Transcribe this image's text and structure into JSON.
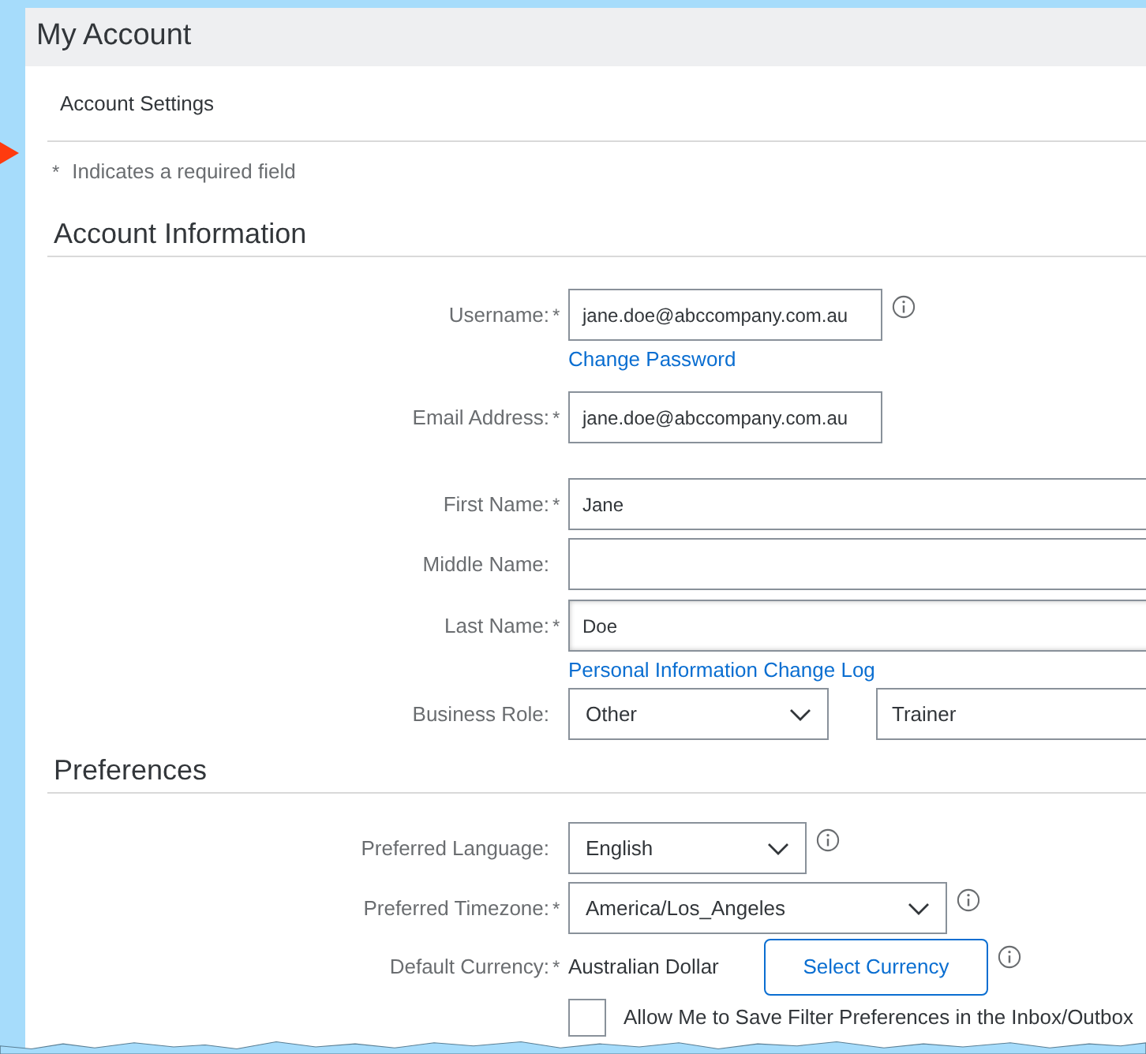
{
  "page": {
    "title": "My Account"
  },
  "tab": {
    "label": "Account Settings"
  },
  "required_note": {
    "mark": "*",
    "text": "Indicates a required field"
  },
  "sections": [
    {
      "title": "Account Information",
      "rows": [
        {
          "kind": "input",
          "label": "Username:",
          "required": true,
          "value": "jane.doe@abccompany.com.au",
          "info": true,
          "link": "Change Password"
        },
        {
          "kind": "input",
          "label": "Email Address:",
          "required": true,
          "value": "jane.doe@abccompany.com.au",
          "info": false
        },
        {
          "kind": "input",
          "label": "First Name:",
          "required": true,
          "value": "Jane",
          "info": false
        },
        {
          "kind": "input",
          "label": "Middle Name:",
          "required": false,
          "value": "",
          "info": false
        },
        {
          "kind": "input",
          "label": "Last Name:",
          "required": true,
          "value": "Doe",
          "info": false,
          "link": "Personal Information Change Log"
        },
        {
          "kind": "select_text",
          "label": "Business Role:",
          "required": false,
          "value": "Other",
          "extra_value": "Trainer",
          "info": false
        }
      ]
    },
    {
      "title": "Preferences",
      "rows": [
        {
          "kind": "select",
          "label": "Preferred Language:",
          "required": false,
          "value": "English",
          "info": true
        },
        {
          "kind": "select",
          "label": "Preferred Timezone:",
          "required": true,
          "value": "America/Los_Angeles",
          "info": true
        },
        {
          "kind": "static_button",
          "label": "Default Currency:",
          "required": true,
          "value": "Australian Dollar",
          "button": "Select Currency",
          "info": true
        },
        {
          "kind": "checkbox",
          "label": "Allow Me to Save Filter Preferences in the Inbox/Outbox",
          "checked": false
        }
      ]
    }
  ]
}
